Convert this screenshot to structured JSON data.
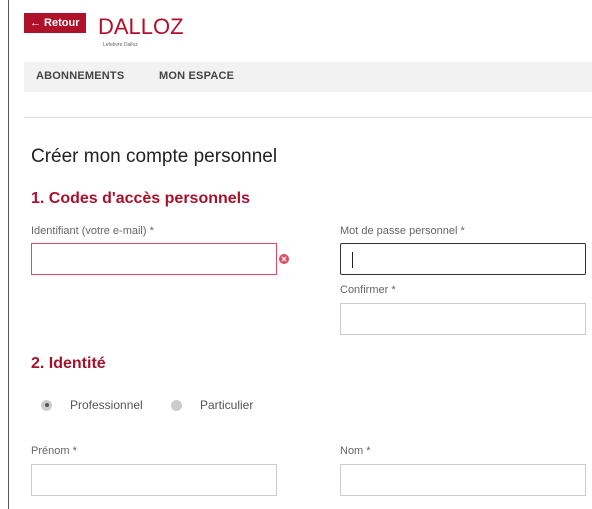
{
  "header": {
    "back_label": "← Retour",
    "logo_text": "DALLOZ",
    "logo_subtitle": "Lefebvre Dalloz"
  },
  "nav": {
    "items": [
      {
        "label": "ABONNEMENTS"
      },
      {
        "label": "MON ESPACE"
      }
    ]
  },
  "page": {
    "title": "Créer mon compte personnel"
  },
  "sections": {
    "access": {
      "title": "1. Codes d'accès personnels",
      "email_label": "Identifiant (votre e-mail) *",
      "email_value": "",
      "password_label": "Mot de passe personnel *",
      "password_value": "",
      "confirm_label": "Confirmer *",
      "confirm_value": ""
    },
    "identity": {
      "title": "2. Identité",
      "options": [
        {
          "label": "Professionnel",
          "checked": true
        },
        {
          "label": "Particulier",
          "checked": false
        }
      ],
      "firstname_label": "Prénom *",
      "firstname_value": "",
      "lastname_label": "Nom *",
      "lastname_value": ""
    }
  },
  "colors": {
    "brand": "#b0112a",
    "section_title": "#a7122d",
    "error": "#e34a5f",
    "nav_bg": "#f2f2f2"
  },
  "icons": {
    "error": "error-icon"
  }
}
